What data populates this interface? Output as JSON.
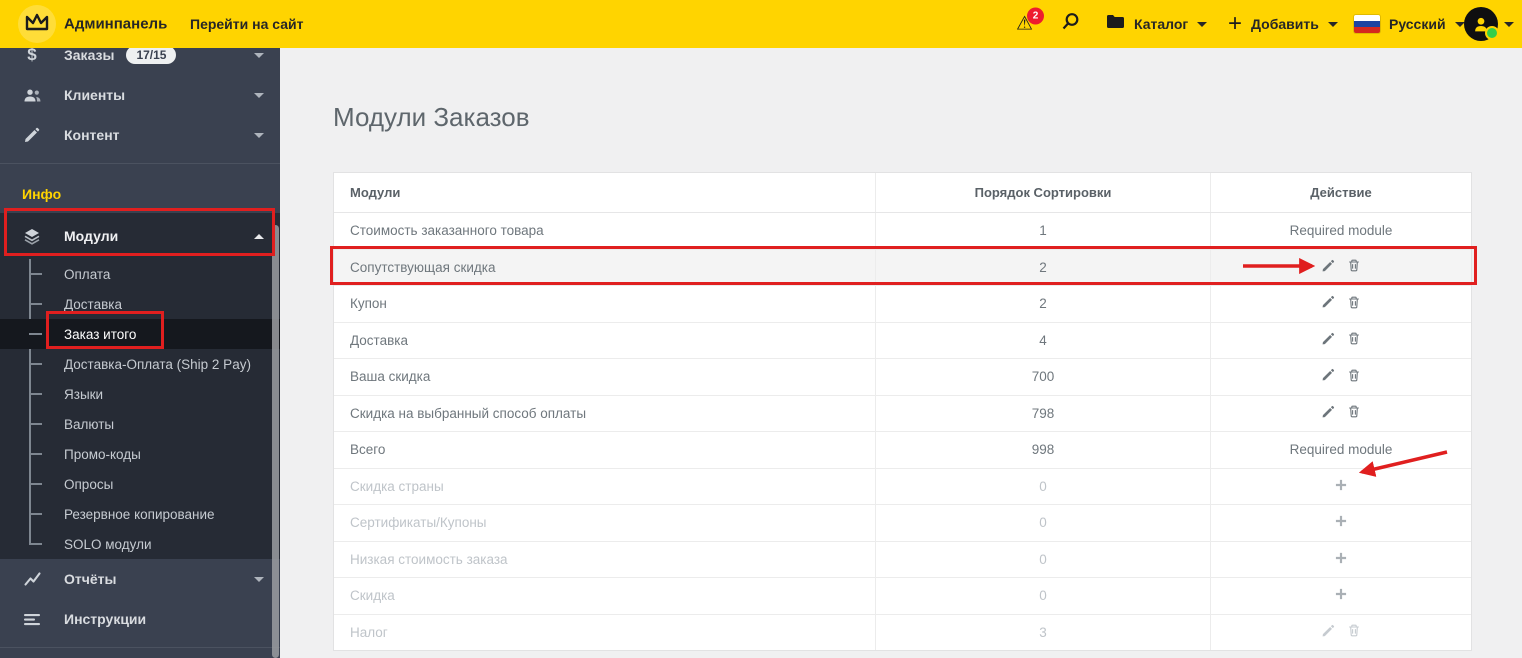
{
  "topbar": {
    "brand": "Админпанель",
    "go_to_site": "Перейти на сайт",
    "alerts_badge": "2",
    "catalog": "Каталог",
    "add": "Добавить",
    "language": "Русский"
  },
  "sidebar": {
    "items": [
      {
        "label": "Заказы",
        "badge": "17/15"
      },
      {
        "label": "Клиенты"
      },
      {
        "label": "Контент"
      }
    ],
    "section": "Инфо",
    "modules": "Модули",
    "submenu": [
      "Оплата",
      "Доставка",
      "Заказ итого",
      "Доставка-Оплата (Ship 2 Pay)",
      "Языки",
      "Валюты",
      "Промо-коды",
      "Опросы",
      "Резервное копирование",
      "SOLO модули"
    ],
    "active_item": "Заказ итого",
    "reports": "Отчёты",
    "instructions": "Инструкции"
  },
  "main": {
    "title": "Модули Заказов",
    "table": {
      "columns": [
        "Модули",
        "Порядок Сортировки",
        "Действие"
      ],
      "required_label": "Required module",
      "rows": [
        {
          "name": "Стоимость заказанного товара",
          "order": "1",
          "action": "required",
          "state": "normal"
        },
        {
          "name": "Сопутствующая скидка",
          "order": "2",
          "action": "edit",
          "state": "highlighted"
        },
        {
          "name": "Купон",
          "order": "2",
          "action": "edit",
          "state": "normal"
        },
        {
          "name": "Доставка",
          "order": "4",
          "action": "edit",
          "state": "normal"
        },
        {
          "name": "Ваша скидка",
          "order": "700",
          "action": "edit",
          "state": "normal"
        },
        {
          "name": "Скидка на выбранный способ оплаты",
          "order": "798",
          "action": "edit",
          "state": "normal"
        },
        {
          "name": "Всего",
          "order": "998",
          "action": "required",
          "state": "normal"
        },
        {
          "name": "Скидка страны",
          "order": "0",
          "action": "install",
          "state": "disabled"
        },
        {
          "name": "Сертификаты/Купоны",
          "order": "0",
          "action": "install",
          "state": "disabled"
        },
        {
          "name": "Низкая стоимость заказа",
          "order": "0",
          "action": "install",
          "state": "disabled"
        },
        {
          "name": "Скидка",
          "order": "0",
          "action": "install",
          "state": "disabled"
        },
        {
          "name": "Налог",
          "order": "3",
          "action": "edit_disabled",
          "state": "disabled"
        }
      ]
    }
  },
  "colors": {
    "topbar_yellow": "#ffd400",
    "annotation_red": "#e01f1f",
    "sidebar_bg": "#3a4150",
    "sidebar_panel": "#262b35",
    "sidebar_active": "#15181e",
    "info_label_yellow": "#ffd400",
    "alert_badge_red": "#ee1c2e",
    "online_green": "#35ce4a"
  }
}
